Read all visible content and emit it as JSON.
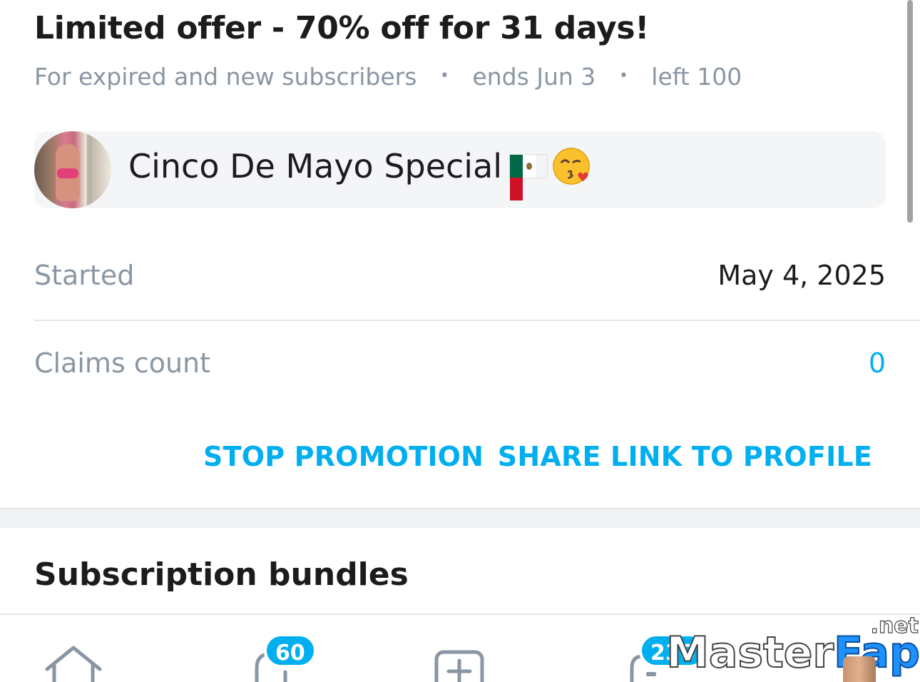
{
  "offer": {
    "title": "Limited offer - 70% off for 31 days!",
    "audience": "For expired and new subscribers",
    "ends": "ends Jun 3",
    "left": "left 100",
    "separator": "•"
  },
  "promo": {
    "message": "Cinco De Mayo Special",
    "emoji_icons": [
      "mexico-flag-icon",
      "face-blowing-kiss-icon"
    ]
  },
  "details": {
    "started_label": "Started",
    "started_value": "May 4, 2025",
    "claims_label": "Claims count",
    "claims_value": "0"
  },
  "actions": {
    "stop_label": "STOP PROMOTION",
    "share_label": "SHARE LINK TO PROFILE"
  },
  "section": {
    "title": "Subscription bundles"
  },
  "bottom_nav": {
    "items": [
      {
        "icon": "home-icon",
        "badge": ""
      },
      {
        "icon": "messages-icon",
        "badge": "60"
      },
      {
        "icon": "add-post-icon",
        "badge": ""
      },
      {
        "icon": "notifications-icon",
        "badge": "230"
      }
    ]
  },
  "watermark": {
    "master": "Master",
    "fap": "Fap",
    "net": ".net"
  },
  "colors": {
    "accent": "#00aff0",
    "muted_text": "#8a96a3",
    "primary_text": "#1c1c1e",
    "divider": "#e3e6e9"
  }
}
